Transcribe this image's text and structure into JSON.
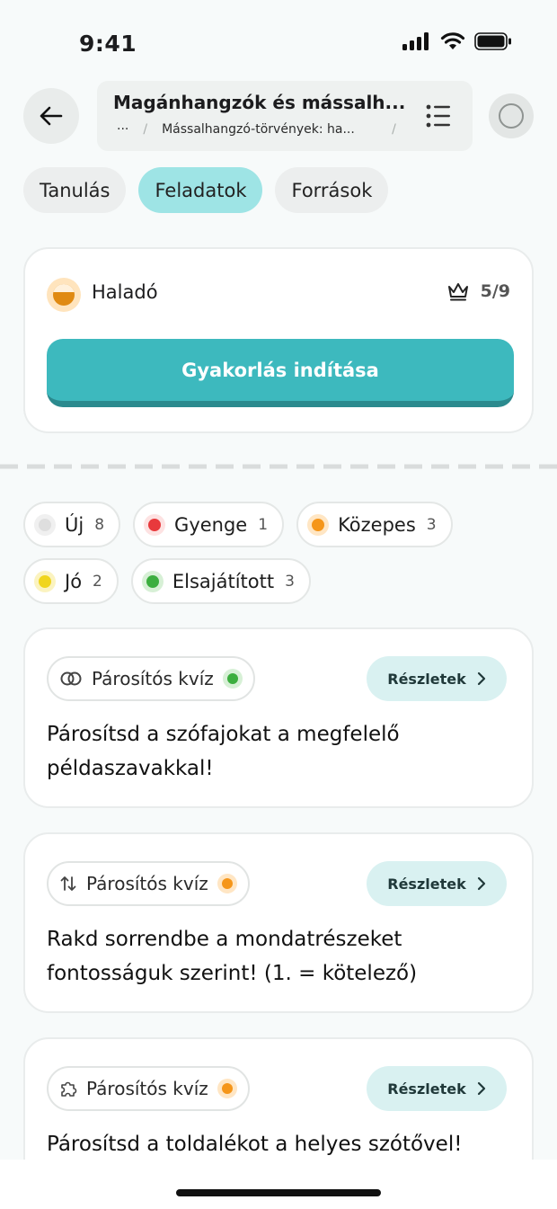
{
  "status_bar": {
    "time": "9:41"
  },
  "header": {
    "title": "Magánhangzók és mássalh...",
    "breadcrumb": {
      "ellipsis": "···",
      "current": "Mássalhangzó-törvények: ha..."
    }
  },
  "tabs": [
    {
      "label": "Tanulás",
      "active": false
    },
    {
      "label": "Feladatok",
      "active": true
    },
    {
      "label": "Források",
      "active": false
    }
  ],
  "level_card": {
    "level": "Haladó",
    "score": "5/9",
    "start_label": "Gyakorlás indítása"
  },
  "filters": [
    {
      "label": "Új",
      "count": "8",
      "color": "#e0e0e0",
      "ring": "#f0f0f0"
    },
    {
      "label": "Gyenge",
      "count": "1",
      "color": "#e8393c",
      "ring": "#fde2e2"
    },
    {
      "label": "Közepes",
      "count": "3",
      "color": "#f5961a",
      "ring": "#ffe6c4"
    },
    {
      "label": "Jó",
      "count": "2",
      "color": "#f0d51e",
      "ring": "#fbf3c0"
    },
    {
      "label": "Elsajátított",
      "count": "3",
      "color": "#3cae3f",
      "ring": "#d7f0d6"
    }
  ],
  "tasks": [
    {
      "type": "Párosítós kvíz",
      "icon": "match-rings-icon",
      "status_color": "#3cae3f",
      "status_ring": "#d7f0d6",
      "details": "Részletek",
      "text": "Párosítsd a szófajokat a megfelelő példaszavakkal!"
    },
    {
      "type": "Párosítós kvíz",
      "icon": "sort-arrows-icon",
      "status_color": "#f5961a",
      "status_ring": "#ffe6c4",
      "details": "Részletek",
      "text": "Rakd sorrendbe a mondatrészeket fontosságuk szerint! (1. = kötelező)"
    },
    {
      "type": "Párosítós kvíz",
      "icon": "puzzle-icon",
      "status_color": "#f5961a",
      "status_ring": "#ffe6c4",
      "details": "Részletek",
      "text": "Párosítsd a toldalékot a helyes szótővel!"
    }
  ]
}
